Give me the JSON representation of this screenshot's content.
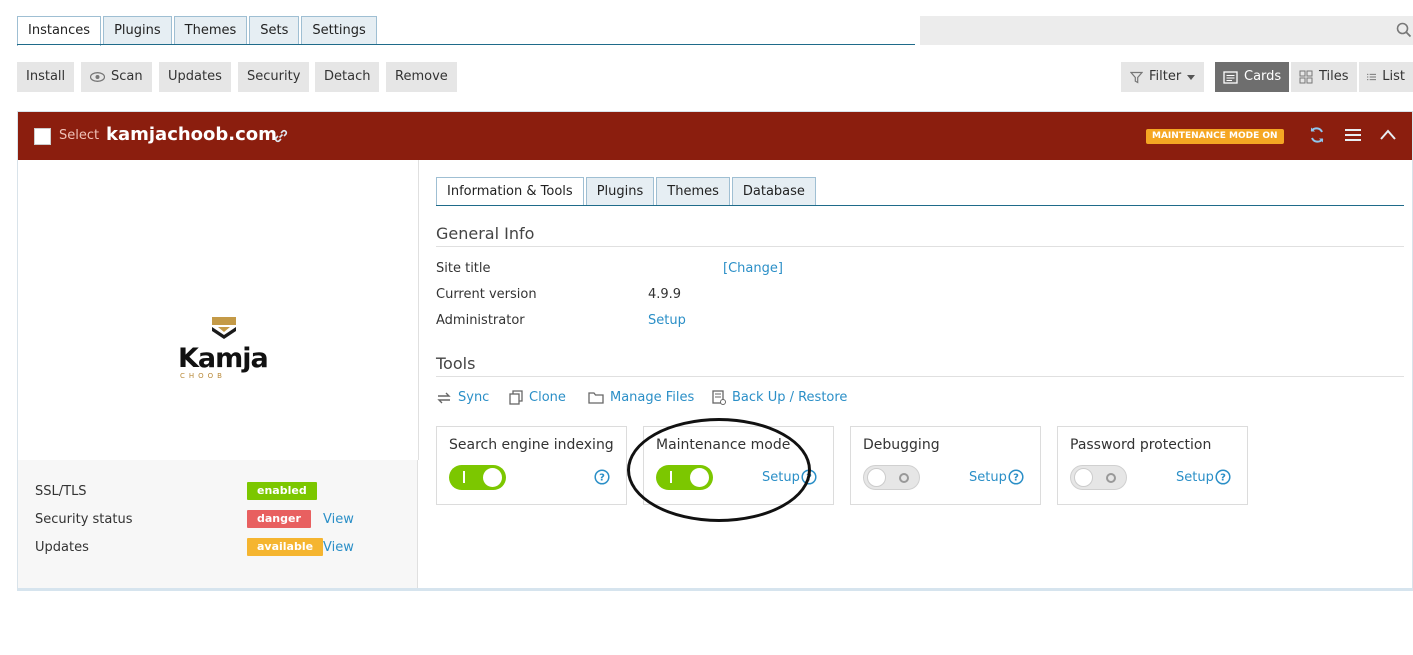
{
  "tabs": [
    "Instances",
    "Plugins",
    "Themes",
    "Sets",
    "Settings"
  ],
  "toolbar": {
    "install": "Install",
    "scan": "Scan",
    "updates": "Updates",
    "security": "Security",
    "detach": "Detach",
    "remove": "Remove",
    "filter": "Filter",
    "views": {
      "cards": "Cards",
      "tiles": "Tiles",
      "list": "List"
    }
  },
  "card": {
    "select_label": "Select",
    "site_name": "kamjachoob.com",
    "badge": "MAINTENANCE MODE ON",
    "logo": {
      "text": "Kamja",
      "sub": "CHOOB"
    },
    "status": {
      "ssl_label": "SSL/TLS",
      "ssl_value": "enabled",
      "security_label": "Security status",
      "security_value": "danger",
      "security_link": "View",
      "updates_label": "Updates",
      "updates_value": "available",
      "updates_link": "View"
    },
    "inner_tabs": [
      "Information & Tools",
      "Plugins",
      "Themes",
      "Database"
    ],
    "general_info": {
      "title": "General Info",
      "site_title_label": "Site title",
      "site_title_link": "[Change]",
      "version_label": "Current version",
      "version_value": "4.9.9",
      "admin_label": "Administrator",
      "admin_link": "Setup"
    },
    "tools": {
      "title": "Tools",
      "sync": "Sync",
      "clone": "Clone",
      "manage_files": "Manage Files",
      "backup": "Back Up / Restore"
    },
    "toggles": [
      {
        "title": "Search engine indexing",
        "state": "on",
        "setup": ""
      },
      {
        "title": "Maintenance mode",
        "state": "on",
        "setup": "Setup"
      },
      {
        "title": "Debugging",
        "state": "off",
        "setup": "Setup"
      },
      {
        "title": "Password protection",
        "state": "off",
        "setup": "Setup"
      }
    ]
  },
  "colors": {
    "header": "#8b1e0e",
    "badge": "#f5a623",
    "enabled": "#7cc700",
    "danger": "#e86060",
    "available": "#f5b530",
    "link": "#2b8fc7"
  }
}
